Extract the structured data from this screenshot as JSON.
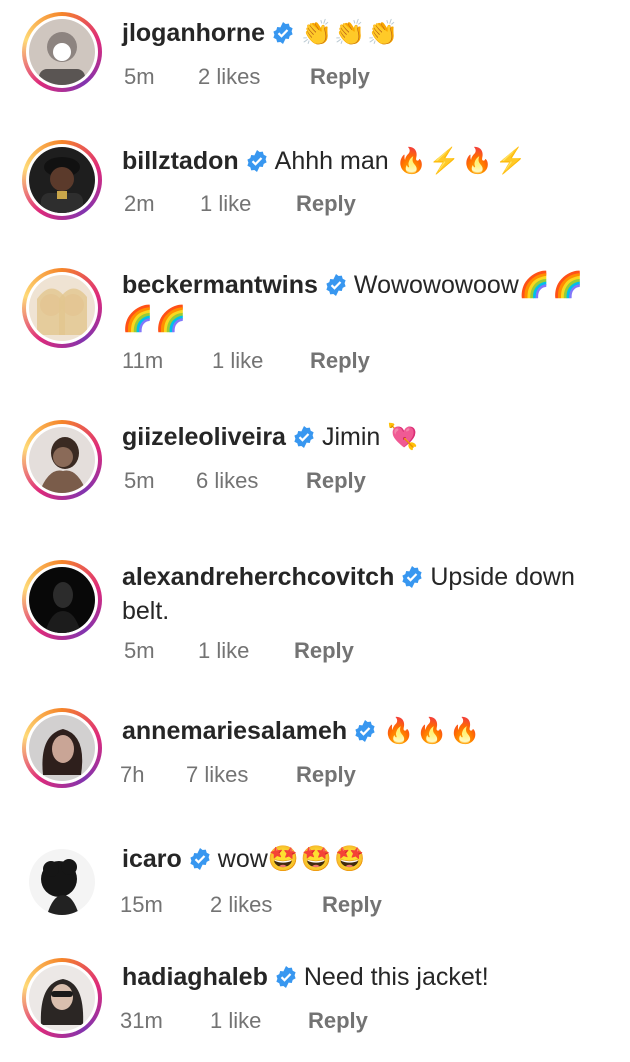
{
  "comments": [
    {
      "username": "jloganhorne",
      "text": "",
      "emojis": "👏👏👏",
      "time": "5m",
      "likes": "2 likes",
      "reply": "Reply",
      "avatar_colors": [
        "#c7b9b0",
        "#6b6461"
      ]
    },
    {
      "username": "billztadon",
      "text": "Ahhh man",
      "emojis": "🔥⚡🔥⚡",
      "time": "2m",
      "likes": "1 like",
      "reply": "Reply",
      "avatar_colors": [
        "#2a2a2a",
        "#6a4a3a"
      ]
    },
    {
      "username": "beckermantwins",
      "text": "Wowowowoow",
      "emojis": "🌈🌈🌈🌈",
      "time": "11m",
      "likes": "1 like",
      "reply": "Reply",
      "avatar_colors": [
        "#e9d9c2",
        "#b79a7f"
      ]
    },
    {
      "username": "giizeleoliveira",
      "text": "Jimin",
      "emojis": "💘",
      "time": "5m",
      "likes": "6 likes",
      "reply": "Reply",
      "avatar_colors": [
        "#d8d2cf",
        "#3b2b24"
      ]
    },
    {
      "username": "alexandreherchcovitch",
      "text": "Upside down belt.",
      "emojis": "",
      "time": "5m",
      "likes": "1 like",
      "reply": "Reply",
      "avatar_colors": [
        "#0c0c0c",
        "#3d3d3d"
      ]
    },
    {
      "username": "annemariesalameh",
      "text": "",
      "emojis": "🔥🔥🔥",
      "time": "7h",
      "likes": "7 likes",
      "reply": "Reply",
      "avatar_colors": [
        "#dadada",
        "#3a2a28"
      ]
    },
    {
      "username": "icaro",
      "text": "wow",
      "emojis": "🤩🤩🤩",
      "time": "15m",
      "likes": "2 likes",
      "reply": "Reply",
      "avatar_colors": [
        "#f2f2f2",
        "#111111"
      ]
    },
    {
      "username": "hadiaghaleb",
      "text": "Need this jacket!",
      "emojis": "",
      "time": "31m",
      "likes": "1 like",
      "reply": "Reply",
      "avatar_colors": [
        "#e6e2df",
        "#2b2725"
      ]
    }
  ],
  "colors": {
    "verified": "#3897f0",
    "meta": "#737373",
    "text": "#262626"
  }
}
